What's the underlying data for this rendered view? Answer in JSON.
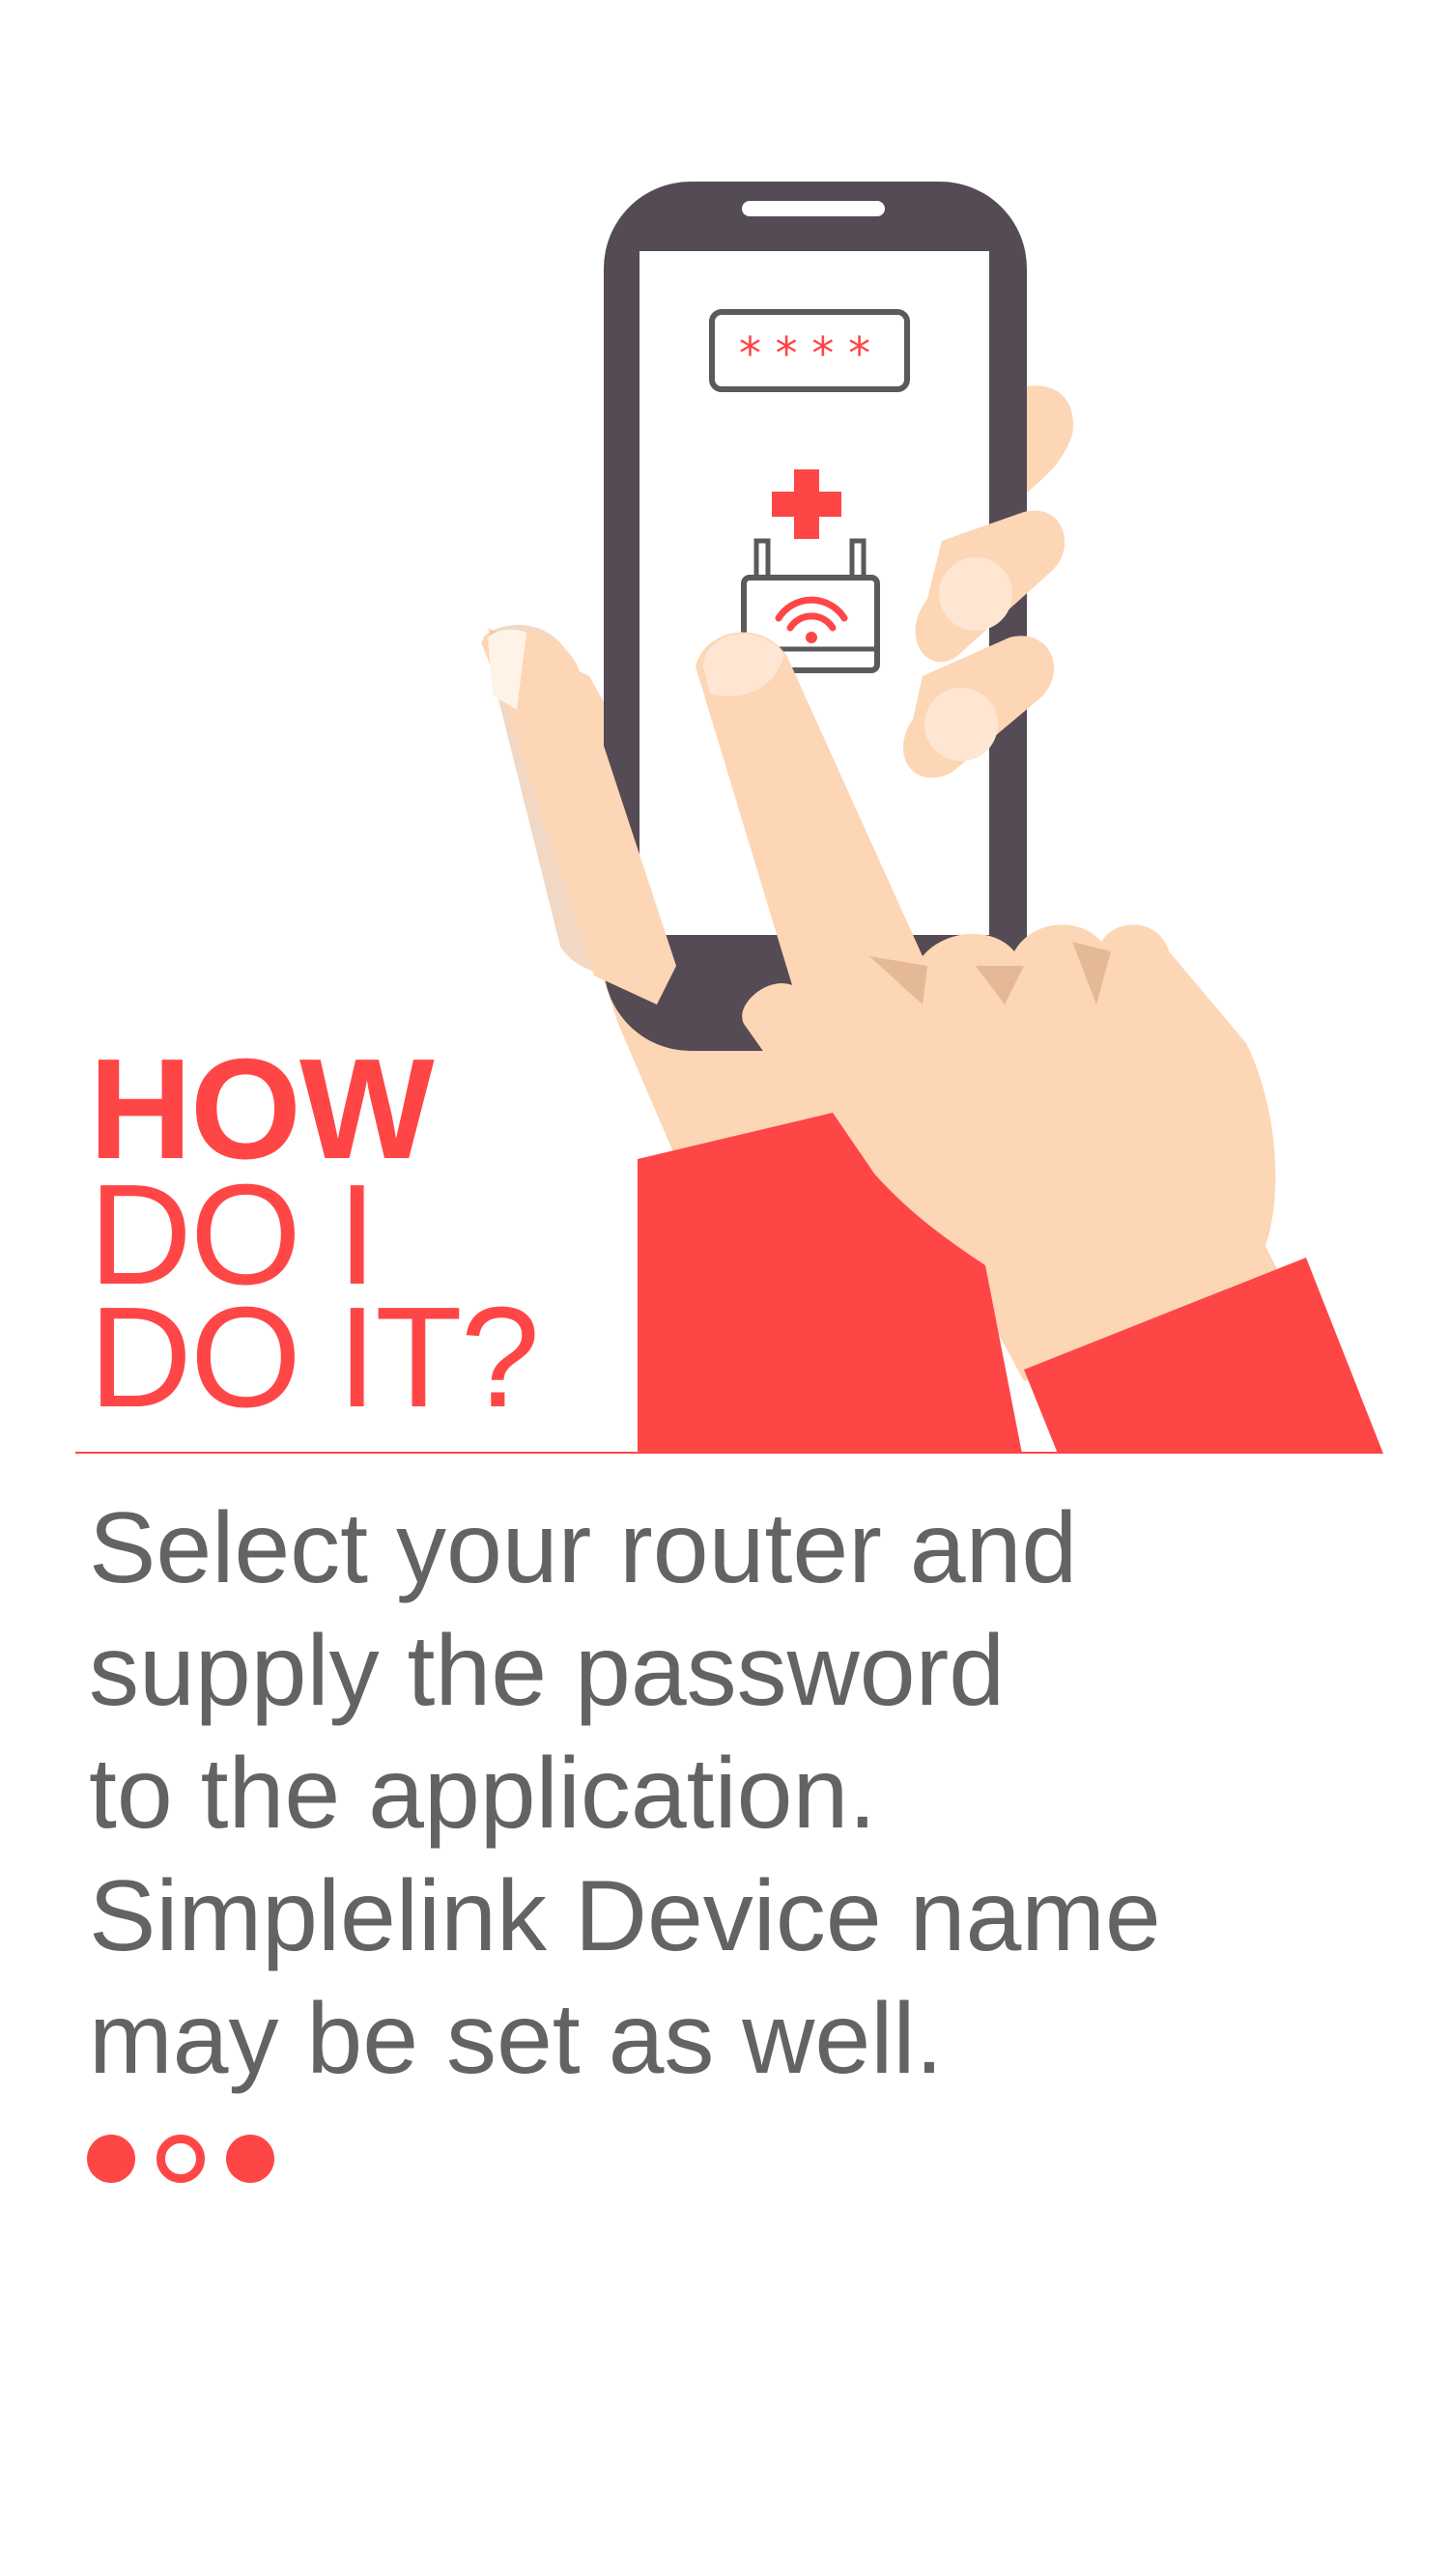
{
  "heading": {
    "line1": "HOW",
    "line2": "DO I",
    "line3": "DO IT?"
  },
  "phone_screen": {
    "password_mask": "****",
    "icons": [
      "password-field-icon",
      "plus-icon",
      "router-icon",
      "wifi-icon"
    ]
  },
  "body": {
    "lines": [
      "Select your router and",
      "supply the password",
      "to the application.",
      "Simplelink Device name",
      "may be set as well."
    ]
  },
  "pager": {
    "current_page": 2,
    "total_pages": 3
  },
  "colors": {
    "accent": "#ff4646",
    "text": "#636363",
    "phone_body": "#544b54",
    "skin": "#fcd6b5",
    "skin_shadow": "#e5b995"
  }
}
